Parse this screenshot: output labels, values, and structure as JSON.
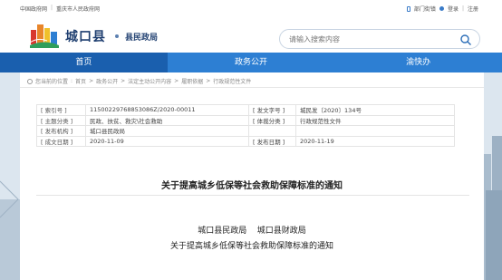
{
  "topbar": {
    "left_links": [
      "中国政府网",
      "重庆市人民政府网"
    ],
    "right_links": [
      "部门街镇",
      "登录",
      "注册"
    ],
    "separator": "|"
  },
  "header": {
    "site_title": "城口县",
    "site_subtitle": "县民政局",
    "search_placeholder": "请输入搜索内容"
  },
  "nav": {
    "items": [
      "首页",
      "政务公开",
      "渝快办"
    ],
    "active_index": 0
  },
  "breadcrumb": [
    "您当前的位置",
    "首页",
    "政务公开",
    "法定主动公开内容",
    "履职依据",
    "行政规范性文件"
  ],
  "info_table": {
    "rows": [
      {
        "k1": "[ 索引号 ]",
        "v1": "11500229768853086Z/2020-00011",
        "k2": "[ 发文字号 ]",
        "v2": "城民发〔2020〕134号"
      },
      {
        "k1": "[ 主题分类 ]",
        "v1": "民政、扶贫、救灾\\社会救助",
        "k2": "[ 体裁分类 ]",
        "v2": "行政规范性文件"
      },
      {
        "k1": "[ 发布机构 ]",
        "v1": "城口县民政局",
        "k2": "",
        "v2": ""
      },
      {
        "k1": "[ 成文日期 ]",
        "v1": "2020-11-09",
        "k2": "[ 发布日期 ]",
        "v2": "2020-11-19"
      }
    ]
  },
  "document": {
    "title": "关于提高城乡低保等社会救助保障标准的通知",
    "issuers": "城口县民政局    城口县财政局",
    "subtitle": "关于提高城乡低保等社会救助保障标准的通知"
  },
  "colors": {
    "nav_bg": "#2d7fd3",
    "nav_active": "#1a5fae",
    "title_blue": "#1f3f70",
    "page_bg": "#dde7f0"
  }
}
